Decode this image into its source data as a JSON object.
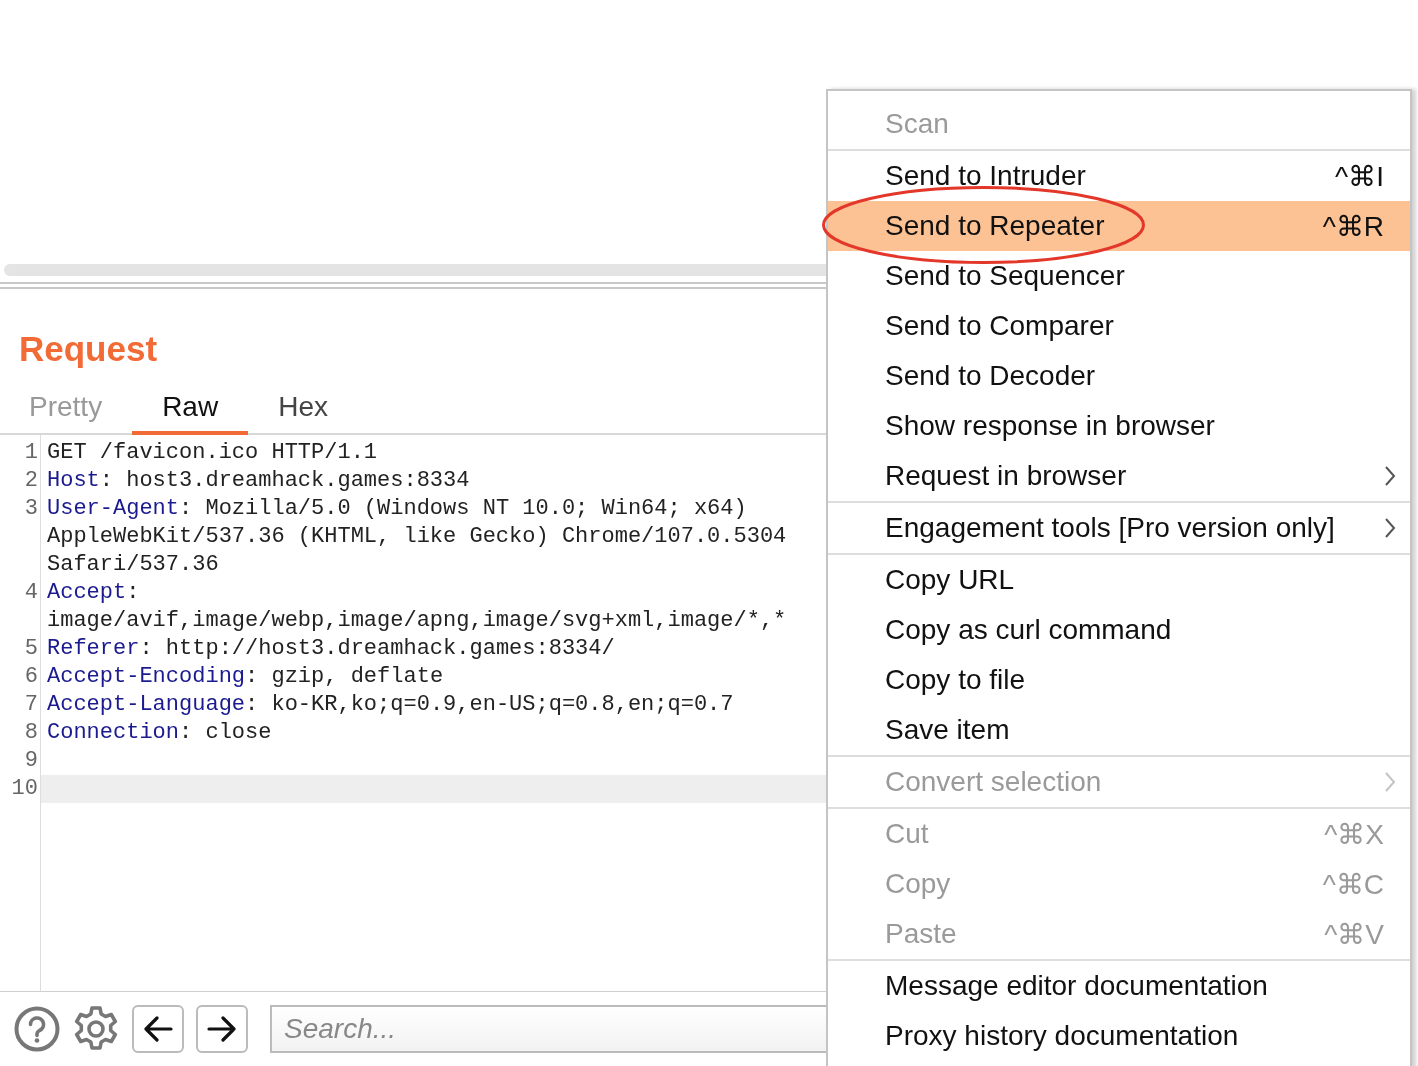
{
  "request": {
    "title": "Request",
    "tabs": [
      {
        "label": "Pretty",
        "selected": false
      },
      {
        "label": "Raw",
        "selected": true
      },
      {
        "label": "Hex",
        "selected": false
      }
    ],
    "lines": [
      {
        "number": "1",
        "text": "GET /favicon.ico HTTP/1.1"
      },
      {
        "number": "2",
        "key": "Host",
        "text": ": host3.dreamhack.games:8334"
      },
      {
        "number": "3",
        "key": "User-Agent",
        "text": ": Mozilla/5.0 (Windows NT 10.0; Win64; x64)",
        "wrapped": [
          "AppleWebKit/537.36 (KHTML, like Gecko) Chrome/107.0.5304",
          "Safari/537.36"
        ]
      },
      {
        "number": "4",
        "key": "Accept",
        "text": ":",
        "wrapped": [
          "image/avif,image/webp,image/apng,image/svg+xml,image/*,*"
        ]
      },
      {
        "number": "5",
        "key": "Referer",
        "text": ": http://host3.dreamhack.games:8334/"
      },
      {
        "number": "6",
        "key": "Accept-Encoding",
        "text": ": gzip, deflate"
      },
      {
        "number": "7",
        "key": "Accept-Language",
        "text": ": ko-KR,ko;q=0.9,en-US;q=0.8,en;q=0.7"
      },
      {
        "number": "8",
        "key": "Connection",
        "text": ": close"
      },
      {
        "number": "9"
      },
      {
        "number": "10",
        "current": true
      }
    ]
  },
  "search": {
    "placeholder": "Search..."
  },
  "context_menu": {
    "sections": [
      {
        "items": [
          {
            "label": "Scan",
            "disabled": true,
            "selected": false,
            "submenu": false,
            "circled": false
          }
        ]
      },
      {
        "items": [
          {
            "label": "Send to Intruder",
            "shortcut": "^⌘I",
            "disabled": false,
            "selected": false,
            "submenu": false,
            "circled": false
          },
          {
            "label": "Send to Repeater",
            "shortcut": "^⌘R",
            "disabled": false,
            "selected": true,
            "submenu": false,
            "circled": true
          },
          {
            "label": "Send to Sequencer",
            "disabled": false,
            "selected": false,
            "submenu": false,
            "circled": false
          },
          {
            "label": "Send to Comparer",
            "disabled": false,
            "selected": false,
            "submenu": false,
            "circled": false
          },
          {
            "label": "Send to Decoder",
            "disabled": false,
            "selected": false,
            "submenu": false,
            "circled": false
          },
          {
            "label": "Show response in browser",
            "disabled": false,
            "selected": false,
            "submenu": false,
            "circled": false
          },
          {
            "label": "Request in browser",
            "disabled": false,
            "selected": false,
            "submenu": true,
            "circled": false
          }
        ]
      },
      {
        "items": [
          {
            "label": "Engagement tools [Pro version only]",
            "disabled": false,
            "selected": false,
            "submenu": true,
            "circled": false
          }
        ]
      },
      {
        "items": [
          {
            "label": "Copy URL",
            "disabled": false,
            "selected": false,
            "submenu": false,
            "circled": false
          },
          {
            "label": "Copy as curl command",
            "disabled": false,
            "selected": false,
            "submenu": false,
            "circled": false
          },
          {
            "label": "Copy to file",
            "disabled": false,
            "selected": false,
            "submenu": false,
            "circled": false
          },
          {
            "label": "Save item",
            "disabled": false,
            "selected": false,
            "submenu": false,
            "circled": false
          }
        ]
      },
      {
        "items": [
          {
            "label": "Convert selection",
            "disabled": true,
            "selected": false,
            "submenu": true,
            "circled": false
          }
        ]
      },
      {
        "items": [
          {
            "label": "Cut",
            "shortcut": "^⌘X",
            "disabled": true,
            "selected": false,
            "submenu": false,
            "circled": false
          },
          {
            "label": "Copy",
            "shortcut": "^⌘C",
            "disabled": true,
            "selected": false,
            "submenu": false,
            "circled": false
          },
          {
            "label": "Paste",
            "shortcut": "^⌘V",
            "disabled": true,
            "selected": false,
            "submenu": false,
            "circled": false
          }
        ]
      },
      {
        "items": [
          {
            "label": "Message editor documentation",
            "disabled": false,
            "selected": false,
            "submenu": false,
            "circled": false
          },
          {
            "label": "Proxy history documentation",
            "disabled": false,
            "selected": false,
            "submenu": false,
            "circled": false
          }
        ]
      }
    ]
  }
}
